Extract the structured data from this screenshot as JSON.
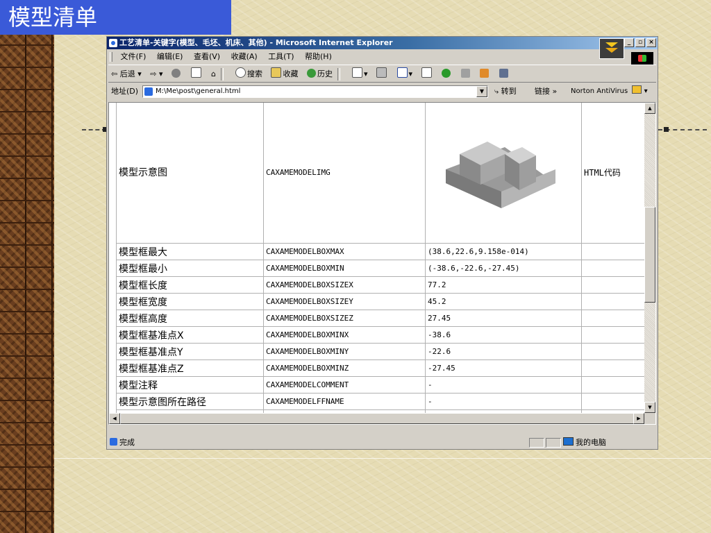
{
  "slide_title": "模型清单",
  "window": {
    "title": "工艺清单-关键字(模型、毛坯、机床、其他) - Microsoft Internet Explorer",
    "caption_buttons": [
      "_",
      "▫",
      "×"
    ]
  },
  "menu": [
    "文件(F)",
    "编辑(E)",
    "查看(V)",
    "收藏(A)",
    "工具(T)",
    "帮助(H)"
  ],
  "toolbar": {
    "back": "后退",
    "search": "搜索",
    "favorites": "收藏",
    "history": "历史"
  },
  "address": {
    "label": "地址(D)",
    "url": "M:\\Me\\post\\general.html",
    "go": "转到",
    "links": "链接 »",
    "norton": "Norton AntiVirus"
  },
  "table": {
    "image_row": {
      "name": "模型示意图",
      "keyword": "CAXAMEMODELIMG",
      "extra": "HTML代码"
    },
    "rows": [
      {
        "name": "模型框最大",
        "keyword": "CAXAMEMODELBOXMAX",
        "value": "(38.6,22.6,9.158e-014)"
      },
      {
        "name": "模型框最小",
        "keyword": "CAXAMEMODELBOXMIN",
        "value": "(-38.6,-22.6,-27.45)"
      },
      {
        "name": "模型框长度",
        "keyword": "CAXAMEMODELBOXSIZEX",
        "value": "77.2"
      },
      {
        "name": "模型框宽度",
        "keyword": "CAXAMEMODELBOXSIZEY",
        "value": "45.2"
      },
      {
        "name": "模型框高度",
        "keyword": "CAXAMEMODELBOXSIZEZ",
        "value": "27.45"
      },
      {
        "name": "模型框基准点X",
        "keyword": "CAXAMEMODELBOXMINX",
        "value": "-38.6"
      },
      {
        "name": "模型框基准点Y",
        "keyword": "CAXAMEMODELBOXMINY",
        "value": "-22.6"
      },
      {
        "name": "模型框基准点Z",
        "keyword": "CAXAMEMODELBOXMINZ",
        "value": "-27.45"
      },
      {
        "name": "模型注释",
        "keyword": "CAXAMEMODELCOMMENT",
        "value": "-"
      },
      {
        "name": "模型示意图所在路径",
        "keyword": "CAXAMEMODELFFNAME",
        "value": "-"
      }
    ]
  },
  "status": {
    "text": "完成",
    "zone": "我的电脑"
  }
}
